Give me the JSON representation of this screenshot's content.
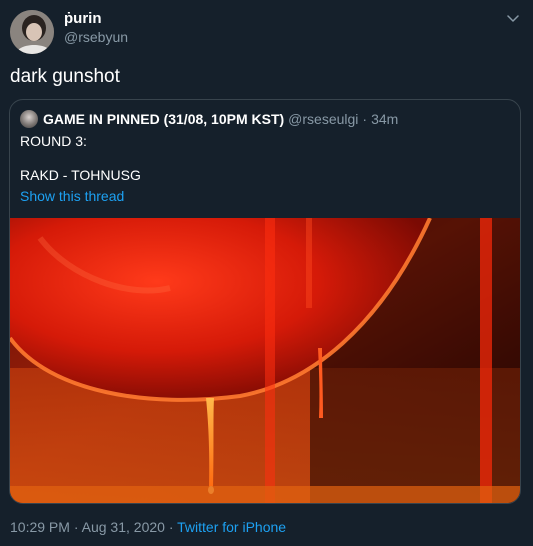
{
  "author": {
    "display_name": "ṗurin",
    "handle": "@rsebyun",
    "avatar_icon": "user-avatar"
  },
  "tweet": {
    "text": "dark gunshot"
  },
  "quoted": {
    "display_name": "GAME IN PINNED (31/08, 10PM KST)",
    "handle": "@rseseulgi",
    "separator": "·",
    "time": "34m",
    "line1": "ROUND 3:",
    "line2": "RAKD - TOHNUSG",
    "thread_link": "Show this thread",
    "media_description_icon": "red-liquid-image"
  },
  "footer": {
    "time": "10:29 PM",
    "sep1": "·",
    "date": "Aug 31, 2020",
    "sep2": "·",
    "source": "Twitter for iPhone"
  },
  "colors": {
    "background": "#15202b",
    "secondary_text": "#8899a6",
    "link": "#1da1f2",
    "border": "#38444d"
  }
}
